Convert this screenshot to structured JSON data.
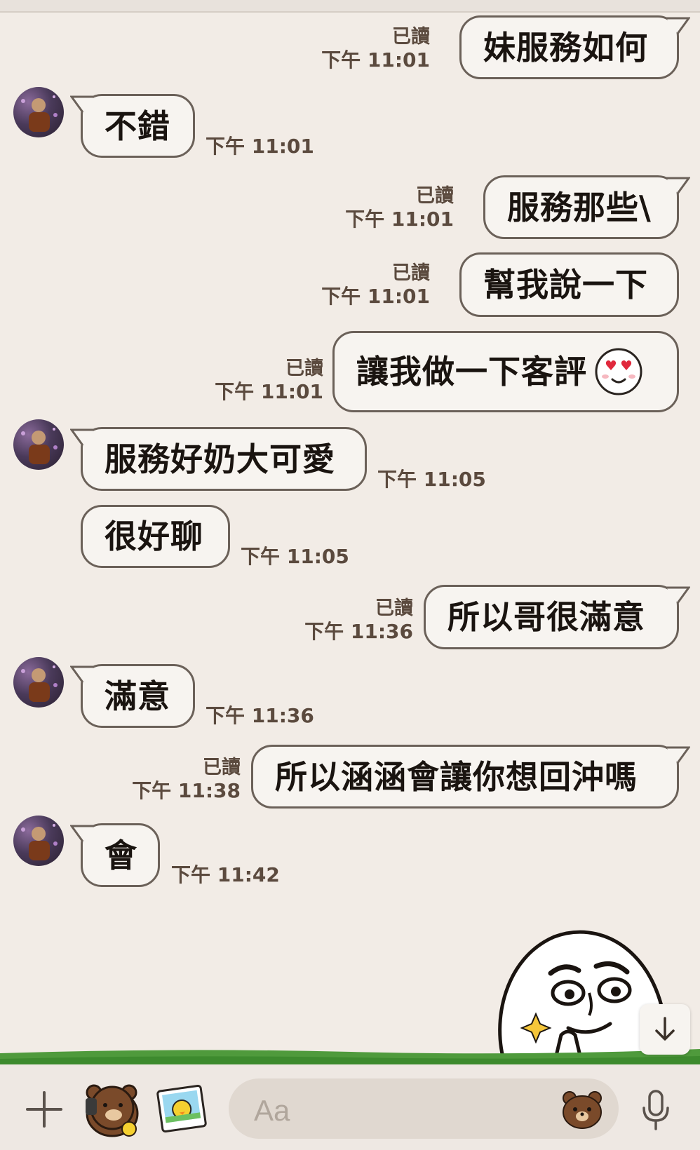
{
  "chat": {
    "messages": [
      {
        "text": "妹服務如何",
        "read": "已讀",
        "time": "下午 11:01"
      },
      {
        "text": "不錯",
        "time": "下午 11:01"
      },
      {
        "text": "服務那些\\",
        "read": "已讀",
        "time": "下午 11:01"
      },
      {
        "text": "幫我說一下",
        "read": "已讀",
        "time": "下午 11:01"
      },
      {
        "text": "讓我做一下客評",
        "read": "已讀",
        "time": "下午 11:01",
        "emoji": "heart-eyes-emoji"
      },
      {
        "text": "服務好奶大可愛",
        "time": "下午 11:05"
      },
      {
        "text": "很好聊",
        "time": "下午 11:05"
      },
      {
        "text": "所以哥很滿意",
        "read": "已讀",
        "time": "下午 11:36"
      },
      {
        "text": "滿意",
        "time": "下午 11:36"
      },
      {
        "text": "所以涵涵會讓你想回沖嗎",
        "read": "已讀",
        "time": "下午 11:38"
      },
      {
        "text": "會",
        "time": "下午 11:42"
      }
    ]
  },
  "input": {
    "placeholder": "Aa"
  },
  "icons": {
    "plus": "plus-icon",
    "sticker": "sticker-icon",
    "photo": "photo-icon",
    "emoji": "emoji-icon",
    "mic": "microphone-icon",
    "scroll": "arrow-down-icon"
  }
}
